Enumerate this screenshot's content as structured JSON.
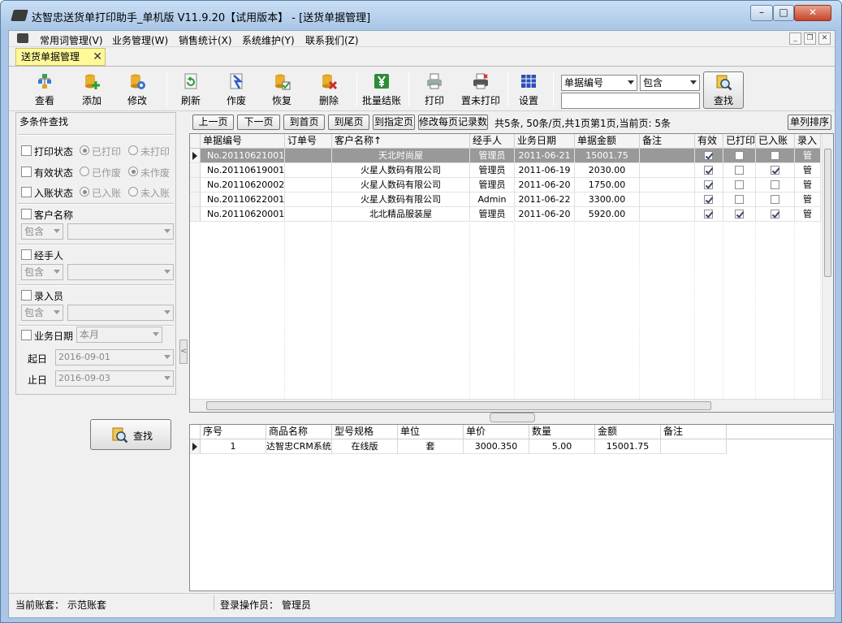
{
  "window": {
    "title": "达智忠送货单打印助手_单机版 V11.9.20【试用版本】 - [送货单据管理]",
    "min": "–",
    "max": "□",
    "close": "✕"
  },
  "menu": {
    "items": [
      "常用词管理(V)",
      "业务管理(W)",
      "销售统计(X)",
      "系统维护(Y)",
      "联系我们(Z)"
    ]
  },
  "doc_tab": {
    "label": "送货单据管理",
    "close": "✕"
  },
  "toolbar": {
    "buttons": [
      "查看",
      "添加",
      "修改",
      "刷新",
      "作废",
      "恢复",
      "删除",
      "批量结账",
      "打印",
      "置未打印",
      "设置"
    ],
    "field_combo": "单据编号",
    "op_combo": "包含",
    "search_value": "",
    "search_button": "查找"
  },
  "left": {
    "title": "多条件查找",
    "print_status": {
      "label": "打印状态",
      "opt1": "已打印",
      "opt2": "未打印"
    },
    "valid_status": {
      "label": "有效状态",
      "opt1": "已作废",
      "opt2": "未作废"
    },
    "account_status": {
      "label": "入账状态",
      "opt1": "已入账",
      "opt2": "未入账"
    },
    "customer": {
      "label": "客户名称",
      "op": "包含",
      "value": ""
    },
    "handler": {
      "label": "经手人",
      "op": "包含",
      "value": ""
    },
    "recorder": {
      "label": "录入员",
      "op": "包含",
      "value": ""
    },
    "date": {
      "label": "业务日期",
      "period": "本月",
      "start_label": "起日",
      "start": "2016-09-01",
      "end_label": "止日",
      "end": "2016-09-03"
    },
    "search_button": "查找",
    "splitter": "<"
  },
  "pager": {
    "buttons": [
      "上一页",
      "下一页",
      "到首页",
      "到尾页",
      "到指定页",
      "修改每页记录数"
    ],
    "info": "共5条, 50条/页,共1页第1页,当前页: 5条",
    "sort_button": "单列排序"
  },
  "orders": {
    "headers": [
      "单据编号",
      "订单号",
      "客户名称↑",
      "经手人",
      "业务日期",
      "单据金额",
      "备注",
      "有效",
      "已打印",
      "已入账",
      "录入"
    ],
    "rows": [
      {
        "no": "No.20110621001",
        "order": "",
        "customer": "天北时尚屋",
        "handler": "管理员",
        "date": "2011-06-21",
        "amount": "15001.75",
        "note": "",
        "valid": true,
        "printed": false,
        "booked": false,
        "rec": "管"
      },
      {
        "no": "No.20110619001",
        "order": "",
        "customer": "火星人数码有限公司",
        "handler": "管理员",
        "date": "2011-06-19",
        "amount": "2030.00",
        "note": "",
        "valid": true,
        "printed": false,
        "booked": true,
        "rec": "管"
      },
      {
        "no": "No.20110620002",
        "order": "",
        "customer": "火星人数码有限公司",
        "handler": "管理员",
        "date": "2011-06-20",
        "amount": "1750.00",
        "note": "",
        "valid": true,
        "printed": false,
        "booked": false,
        "rec": "管"
      },
      {
        "no": "No.20110622001",
        "order": "",
        "customer": "火星人数码有限公司",
        "handler": "Admin",
        "date": "2011-06-22",
        "amount": "3300.00",
        "note": "",
        "valid": true,
        "printed": false,
        "booked": false,
        "rec": "管"
      },
      {
        "no": "No.20110620001",
        "order": "",
        "customer": "北北精品服装屋",
        "handler": "管理员",
        "date": "2011-06-20",
        "amount": "5920.00",
        "note": "",
        "valid": true,
        "printed": true,
        "booked": true,
        "rec": "管"
      }
    ]
  },
  "details": {
    "headers": [
      "序号",
      "商品名称",
      "型号规格",
      "单位",
      "单价",
      "数量",
      "金额",
      "备注"
    ],
    "rows": [
      {
        "seq": "1",
        "name": "达智忠CRM系统",
        "spec": "在线版",
        "unit": "套",
        "price": "3000.350",
        "qty": "5.00",
        "amount": "15001.75",
        "note": ""
      }
    ]
  },
  "status": {
    "account_label": "当前账套：",
    "account": "示范账套",
    "operator_label": "登录操作员：",
    "operator": "管理员"
  }
}
